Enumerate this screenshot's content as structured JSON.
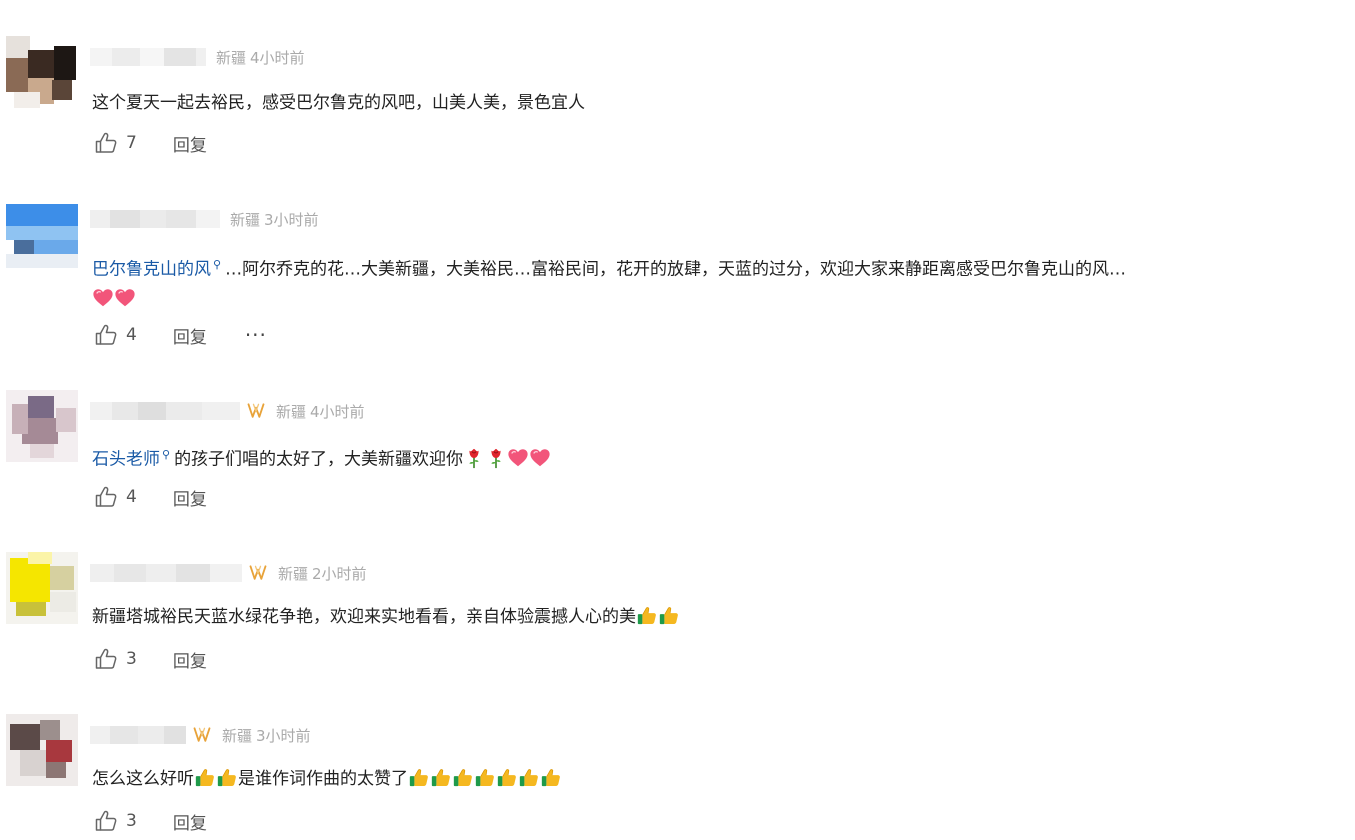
{
  "comments": [
    {
      "location": "新疆",
      "time": "4小时前",
      "has_vip": false,
      "text": "这个夏天一起去裕民，感受巴尔鲁克的风吧，山美人美，景色宜人",
      "likes": "7",
      "reply_label": "回复",
      "like_icon": "thumbs-up-outline",
      "avatar_colors": [
        "#3a2a22",
        "#8a6a55",
        "#c9a98d",
        "#1d1714"
      ]
    },
    {
      "location": "新疆",
      "time": "3小时前",
      "has_vip": false,
      "topic": "巴尔鲁克山的风",
      "text": "…阿尔乔克的花…大美新疆，大美裕民…富裕民间，花开的放肆，天蓝的过分，欢迎大家来静距离感受巴尔鲁克山的风…",
      "trailing_emoji": [
        "heart",
        "heart"
      ],
      "likes": "4",
      "reply_label": "回复",
      "more_label": "···",
      "like_icon": "thumbs-up-outline",
      "avatar_colors": [
        "#3d8ee8",
        "#8fc3f2",
        "#4a6e9c",
        "#6aa9ea"
      ]
    },
    {
      "location": "新疆",
      "time": "4小时前",
      "has_vip": true,
      "topic": "石头老师",
      "text": "的孩子们唱的太好了，大美新疆欢迎你",
      "trailing_emoji": [
        "rose",
        "rose",
        "heart",
        "heart"
      ],
      "likes": "4",
      "reply_label": "回复",
      "like_icon": "thumbs-up-outline",
      "avatar_colors": [
        "#7a6a86",
        "#c7b0b8",
        "#a58a96",
        "#e3d6da"
      ]
    },
    {
      "location": "新疆",
      "time": "2小时前",
      "has_vip": true,
      "text": "新疆塔城裕民天蓝水绿花争艳，欢迎来实地看看，亲自体验震撼人心的美",
      "trailing_emoji": [
        "thumbs",
        "thumbs"
      ],
      "likes": "3",
      "reply_label": "回复",
      "like_icon": "thumbs-up-outline",
      "avatar_colors": [
        "#f5e600",
        "#d6d0a0",
        "#c8c13a",
        "#ecebe5"
      ]
    },
    {
      "location": "新疆",
      "time": "3小时前",
      "has_vip": true,
      "text_parts": [
        "怎么这么好听",
        "是谁作词作曲的太赞了"
      ],
      "mid_emoji": [
        "thumbs",
        "thumbs"
      ],
      "trailing_emoji": [
        "thumbs",
        "thumbs",
        "thumbs",
        "thumbs",
        "thumbs",
        "thumbs",
        "thumbs"
      ],
      "likes": "3",
      "reply_label": "回复",
      "like_icon": "thumbs-up-outline",
      "avatar_colors": [
        "#5b4a48",
        "#a8383e",
        "#9c8f8d",
        "#d8d2d0"
      ]
    }
  ]
}
